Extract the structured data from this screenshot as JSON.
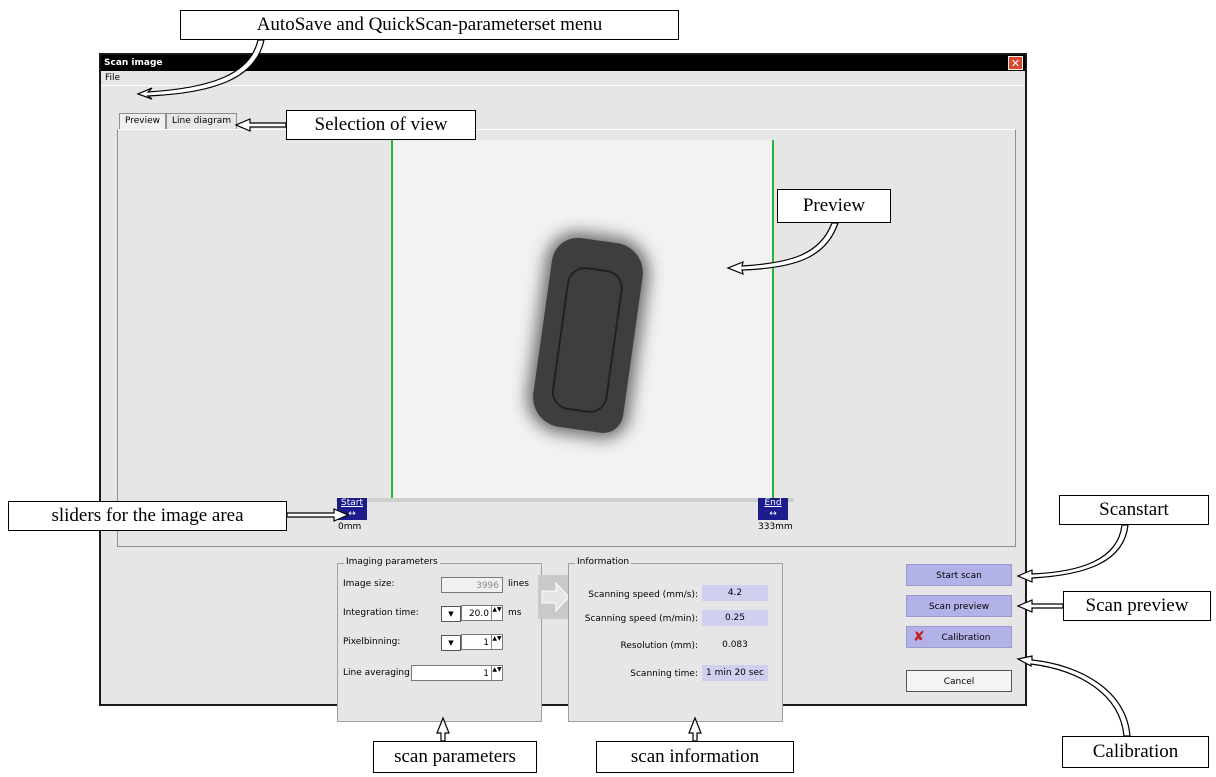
{
  "window": {
    "title": "Scan image",
    "close_glyph": "✕",
    "menu": [
      "File"
    ]
  },
  "tabs": [
    {
      "label": "Preview",
      "active": true
    },
    {
      "label": "Line diagram",
      "active": false
    }
  ],
  "preview": {
    "start_label": "Start",
    "end_label": "End",
    "start_value": "0mm",
    "end_value": "333mm",
    "start_arrow": "↔",
    "end_arrow": "↔"
  },
  "imaging": {
    "title": "Imaging parameters",
    "image_size_label": "Image size:",
    "image_size_value": "3996",
    "image_size_unit": "lines",
    "integration_label": "Integration time:",
    "integration_value": "20.0",
    "integration_unit": "ms",
    "pixelbinning_label": "Pixelbinning:",
    "pixelbinning_value": "1",
    "line_averaging_label": "Line averaging:",
    "line_averaging_value": "1",
    "dropdown_glyph": "▼",
    "spin_glyph": "▲▼"
  },
  "information": {
    "title": "Information",
    "speed_mms_label": "Scanning speed (mm/s):",
    "speed_mms_value": "4.2",
    "speed_mmin_label": "Scanning speed (m/min):",
    "speed_mmin_value": "0.25",
    "resolution_label": "Resolution (mm):",
    "resolution_value": "0.083",
    "time_label": "Scanning time:",
    "time_value": "1 min 20 sec"
  },
  "buttons": {
    "start_scan": "Start scan",
    "scan_preview": "Scan preview",
    "calibration": "Calibration",
    "cancel": "Cancel",
    "calibration_icon_glyph": "✘"
  },
  "callouts": {
    "menu": "AutoSave and QuickScan-parameterset menu",
    "view": "Selection of view",
    "preview": "Preview",
    "sliders": "sliders for the image area",
    "scanstart": "Scanstart",
    "scan_preview": "Scan preview",
    "calibration": "Calibration",
    "scan_parameters": "scan parameters",
    "scan_information": "scan information"
  },
  "colors": {
    "slider_box": "#1c1c8c",
    "range_line": "#2bb33a",
    "value_highlight": "#cfd0ef",
    "action_button": "#b2b2e8",
    "close_button": "#d8482a"
  }
}
